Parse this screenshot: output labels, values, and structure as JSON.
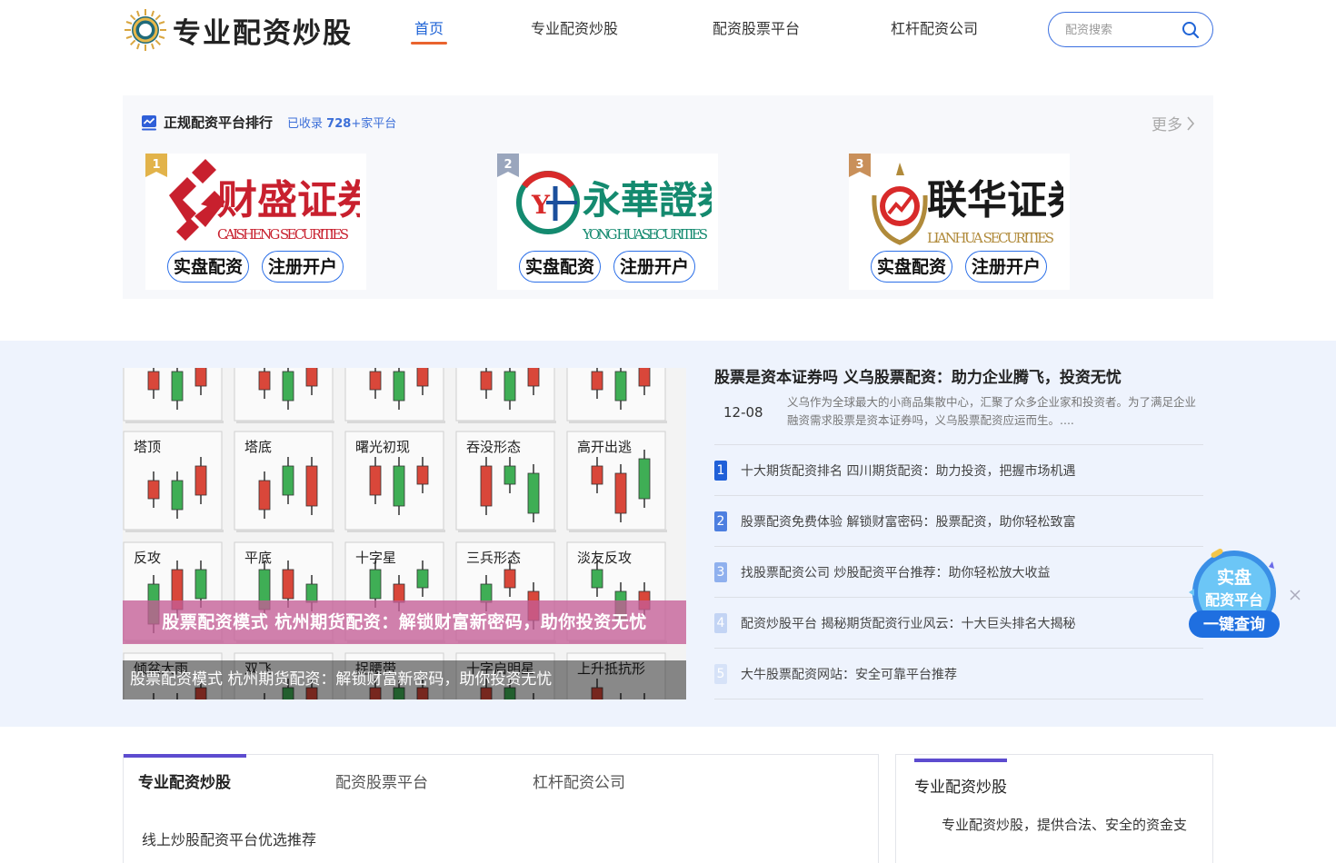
{
  "header": {
    "logo_text": "专业配资炒股",
    "nav": [
      "首页",
      "专业配资炒股",
      "配资股票平台",
      "杠杆配资公司"
    ],
    "search_placeholder": "配资搜索"
  },
  "ranking": {
    "title": "正规配资平台排行",
    "count_prefix": "已收录",
    "count": "728",
    "count_suffix": "+家平台",
    "more": "更多",
    "cards": [
      {
        "rank": "1",
        "name": "财盛证券",
        "english": "CAISHENG SECURITIES",
        "btn1": "实盘配资",
        "btn2": "注册开户",
        "color": "#c8202e"
      },
      {
        "rank": "2",
        "name": "永華證券",
        "english": "YONG HUASECURITIES",
        "btn1": "实盘配资",
        "btn2": "注册开户",
        "color": "#148a6f"
      },
      {
        "rank": "3",
        "name": "联华证券",
        "english": "LIANHUA SECURITIES",
        "btn1": "实盘配资",
        "btn2": "注册开户",
        "color": "#b08a3a"
      }
    ]
  },
  "slider": {
    "banner_text": "股票配资模式 杭州期货配资：解锁财富新密码，助你投资无忧",
    "caption": "股票配资模式 杭州期货配资：解锁财富新密码，助你投资无忧",
    "candle_labels": [
      "塔顶",
      "塔底",
      "曙光初现",
      "吞没形态",
      "高开出逃",
      "反攻",
      "平底",
      "十字星",
      "三兵形态",
      "淡友反攻",
      "倾盆大雨",
      "双飞",
      "捉腰带",
      "十字启明星",
      "上升抵抗形"
    ]
  },
  "news": {
    "lead_title": "股票是资本证券吗 义乌股票配资：助力企业腾飞，投资无忧",
    "lead_date": "12-08",
    "lead_desc": "义乌作为全球最大的小商品集散中心，汇聚了众多企业家和投资者。为了满足企业融资需求股票是资本证券吗，义乌股票配资应运而生。....",
    "items": [
      {
        "num": "1",
        "text": "十大期货配资排名 四川期货配资：助力投资，把握市场机遇",
        "color": "#2060d8"
      },
      {
        "num": "2",
        "text": "股票配资免费体验 解锁财富密码：股票配资，助你轻松致富",
        "color": "#4d7fe0"
      },
      {
        "num": "3",
        "text": "找股票配资公司 炒股配资平台推荐：助你轻松放大收益",
        "color": "#8fb0ee"
      },
      {
        "num": "4",
        "text": "配资炒股平台 揭秘期货配资行业风云：十大巨头排名大揭秘",
        "color": "#c3d4f4"
      },
      {
        "num": "5",
        "text": "大牛股票配资网站：安全可靠平台推荐",
        "color": "#d6e2f8"
      }
    ]
  },
  "float_ad": {
    "line1": "实盘",
    "line2": "配资平台",
    "line3": "一键查询"
  },
  "bottom": {
    "tabs": [
      "专业配资炒股",
      "配资股票平台",
      "杠杆配资公司"
    ],
    "sub_text": "线上炒股配资平台优选推荐",
    "side_title": "专业配资炒股",
    "side_text": "专业配资炒股，提供合法、安全的资金支"
  }
}
